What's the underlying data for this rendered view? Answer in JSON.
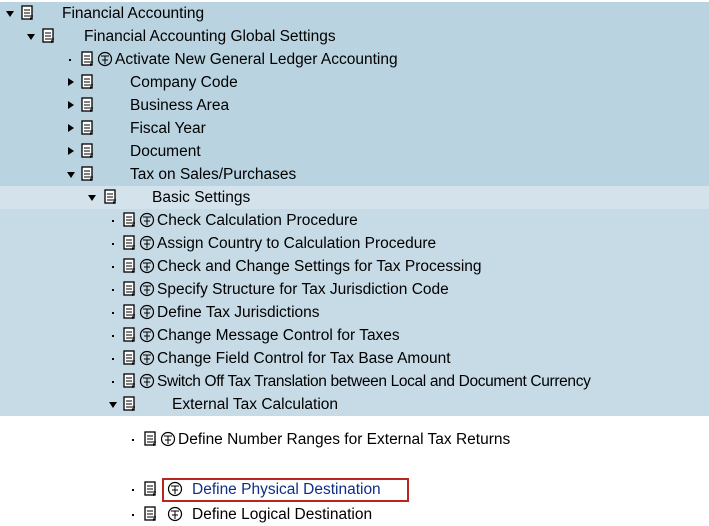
{
  "tree": {
    "nodes": [
      {
        "label": "Financial Accounting",
        "expand": "expanded",
        "has_activity": false
      },
      {
        "label": "Financial Accounting Global Settings",
        "expand": "expanded",
        "has_activity": false
      },
      {
        "label": "Activate New General Ledger Accounting",
        "expand": "leaf",
        "has_activity": true
      },
      {
        "label": "Company Code",
        "expand": "collapsed",
        "has_activity": false
      },
      {
        "label": "Business Area",
        "expand": "collapsed",
        "has_activity": false
      },
      {
        "label": "Fiscal Year",
        "expand": "collapsed",
        "has_activity": false
      },
      {
        "label": "Document",
        "expand": "collapsed",
        "has_activity": false
      },
      {
        "label": "Tax on Sales/Purchases",
        "expand": "expanded",
        "has_activity": false
      },
      {
        "label": "Basic Settings",
        "expand": "expanded",
        "has_activity": false
      },
      {
        "label": "Check Calculation Procedure",
        "expand": "leaf",
        "has_activity": true
      },
      {
        "label": "Assign Country to Calculation Procedure",
        "expand": "leaf",
        "has_activity": true
      },
      {
        "label": "Check and Change Settings for Tax Processing",
        "expand": "leaf",
        "has_activity": true
      },
      {
        "label": "Specify Structure for Tax Jurisdiction Code",
        "expand": "leaf",
        "has_activity": true
      },
      {
        "label": "Define Tax Jurisdictions",
        "expand": "leaf",
        "has_activity": true
      },
      {
        "label": "Change Message Control for Taxes",
        "expand": "leaf",
        "has_activity": true
      },
      {
        "label": "Change Field Control for Tax Base Amount",
        "expand": "leaf",
        "has_activity": true
      },
      {
        "label": "Switch Off Tax Translation between Local and Document Currency",
        "expand": "leaf",
        "has_activity": true
      },
      {
        "label": "External Tax Calculation",
        "expand": "expanded",
        "has_activity": false
      },
      {
        "label": "Define Number Ranges for External Tax Returns",
        "expand": "leaf",
        "has_activity": true
      },
      {
        "label": "Define Physical Destination",
        "expand": "leaf",
        "has_activity": true,
        "selected": true
      },
      {
        "label": "Define Logical Destination",
        "expand": "leaf",
        "has_activity": true
      }
    ]
  },
  "icons": {
    "node": "structure-node-icon",
    "activity": "img-activity-icon",
    "expanded": "triangle-down-icon",
    "collapsed": "triangle-right-icon"
  },
  "colors": {
    "row_shade": "#b9d3e0",
    "selected_link": "#0d2f86",
    "highlight_border": "#b8261f"
  }
}
